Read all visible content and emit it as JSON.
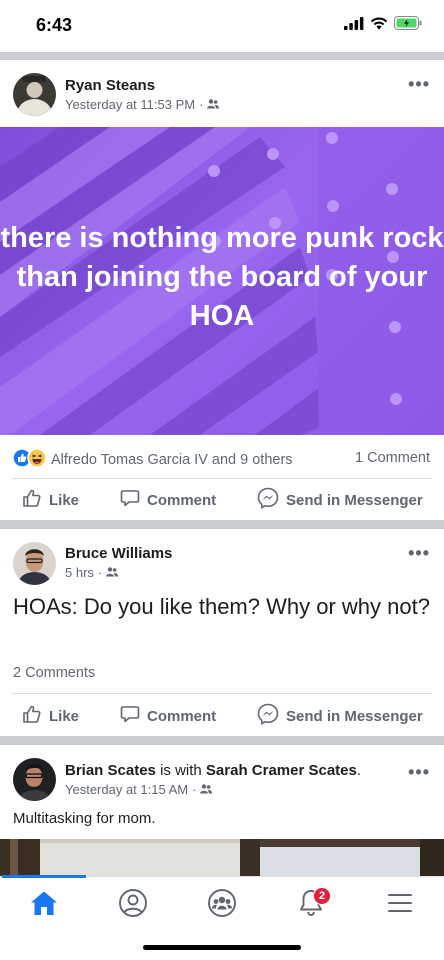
{
  "status_bar": {
    "time": "6:43"
  },
  "posts": [
    {
      "author": "Ryan Steans",
      "timestamp": "Yesterday at 11:53 PM",
      "audience_icon": "friends-icon",
      "banner_text": "there is nothing more punk rock than joining the board of your HOA",
      "banner_color": "#8a5ae6",
      "reactions_text": "Alfredo Tomas Garcia IV and 9 others",
      "comments": "1 Comment"
    },
    {
      "author": "Bruce Williams",
      "timestamp": "5 hrs",
      "audience_icon": "friends-icon",
      "status": "HOAs: Do you like them? Why or why not?",
      "comments": "2 Comments"
    },
    {
      "author": "Brian Scates",
      "with_text": "is with",
      "tagged": "Sarah Cramer Scates",
      "tagged_suffix": ".",
      "timestamp": "Yesterday at 1:15 AM",
      "audience_icon": "friends-icon",
      "caption": "Multitasking for mom."
    }
  ],
  "actions": {
    "like": "Like",
    "comment": "Comment",
    "send": "Send in Messenger"
  },
  "tabbar": {
    "items": [
      "home-icon",
      "profile-icon",
      "groups-icon",
      "notifications-icon",
      "menu-icon"
    ],
    "notifications_badge": "2",
    "accent": "#1877f2"
  }
}
